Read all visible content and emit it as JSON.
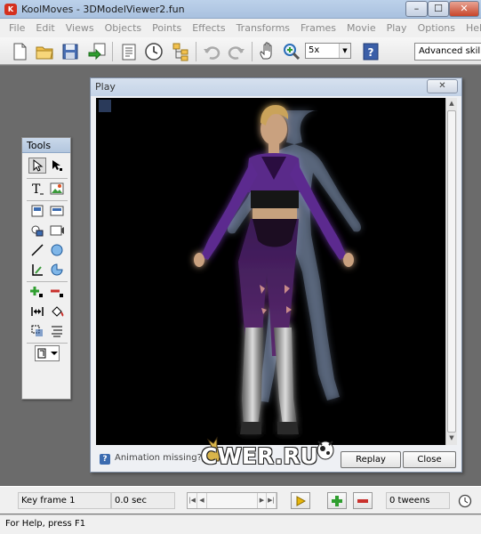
{
  "window": {
    "title": "KoolMoves - 3DModelViewer2.fun",
    "app_icon": "koolmoves-icon",
    "close_glyph": "✕",
    "min_glyph": "–",
    "max_glyph": "☐"
  },
  "menu": {
    "items": [
      "File",
      "Edit",
      "Views",
      "Objects",
      "Points",
      "Effects",
      "Transforms",
      "Frames",
      "Movie",
      "Play",
      "Options",
      "Help"
    ]
  },
  "toolbar": {
    "zoom_value": "5x",
    "skill_level": "Advanced skills"
  },
  "tools_palette": {
    "title": "Tools"
  },
  "play_window": {
    "title": "Play",
    "close_glyph": "✕",
    "help_glyph": "?",
    "message": "Animation missing?",
    "replay_label": "Replay",
    "close_label": "Close"
  },
  "watermark": {
    "text": "CWER.RU"
  },
  "timeline": {
    "keyframe": "Key frame 1",
    "time": "0.0 sec",
    "tweens": "0 tweens"
  },
  "status": {
    "text": "For Help, press F1"
  },
  "colors": {
    "accent": "#c4d3e7",
    "stage_bg": "#000000",
    "add_green": "#2f9e2f",
    "remove_red": "#c9302c",
    "play_yellow": "#e7b50b"
  }
}
